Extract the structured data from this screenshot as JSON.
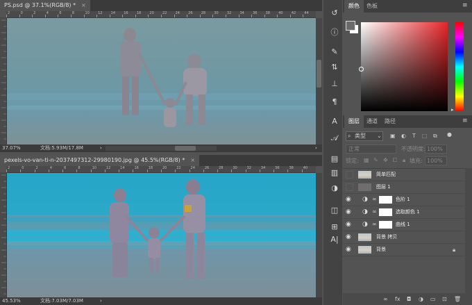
{
  "doc1": {
    "tab_title": "PS.psd @ 37.1%(RGB/8) *",
    "zoom": "37.07%",
    "doc_info": "文档:5.93M/17.8M",
    "ruler_labels": [
      "2",
      "0",
      "2",
      "4",
      "6",
      "8",
      "10",
      "12",
      "14",
      "16",
      "18",
      "20",
      "22",
      "24",
      "26",
      "28",
      "30",
      "32",
      "34",
      "36",
      "38",
      "40",
      "42",
      "44"
    ]
  },
  "doc2": {
    "tab_title": "pexels-vo-van-ti-n-2037497312-29980190.jpg @ 45.5%(RGB/8) *",
    "zoom": "45.53%",
    "doc_info": "文档:7.03M/7.03M",
    "ruler_labels": [
      "2",
      "0",
      "2",
      "4",
      "6",
      "8",
      "10",
      "12",
      "14",
      "16",
      "18",
      "20",
      "22",
      "24",
      "26",
      "28",
      "30",
      "32",
      "34",
      "36",
      "38",
      "40"
    ]
  },
  "tools": [
    "history-icon",
    "info-icon",
    "brush-icon",
    "adjust-icon",
    "clone-stamp-icon",
    "paragraph-icon",
    "character-icon",
    "glyphs-icon",
    "properties-icon",
    "libraries-icon",
    "adjustments-icon",
    "paths-icon",
    "swatches-icon",
    "character-style-icon"
  ],
  "color_panel": {
    "tabs": [
      "颜色",
      "色板"
    ],
    "fg": "#6b6b6b",
    "bg": "#ffffff",
    "hue_base": "#e8262a"
  },
  "layers_panel": {
    "tabs": [
      "图层",
      "通道",
      "路径"
    ],
    "filter_label": "类型",
    "blend_mode": "正常",
    "opacity_label": "不透明度:",
    "opacity_value": "100%",
    "lock_label": "锁定:",
    "fill_label": "填充:",
    "fill_value": "100%",
    "layers": [
      {
        "name": "简单匹配",
        "visible": false,
        "kind": "image",
        "indent": false
      },
      {
        "name": "图层 1",
        "visible": false,
        "kind": "gray",
        "indent": false
      },
      {
        "name": "色阶 1",
        "visible": true,
        "kind": "adjust",
        "indent": true
      },
      {
        "name": "选取颜色 1",
        "visible": true,
        "kind": "adjust",
        "indent": true
      },
      {
        "name": "曲线 1",
        "visible": true,
        "kind": "adjust",
        "indent": true
      },
      {
        "name": "背景 拷贝",
        "visible": true,
        "kind": "image",
        "indent": false
      },
      {
        "name": "背景",
        "visible": true,
        "kind": "image",
        "indent": false,
        "locked": true
      }
    ],
    "bottom_icons": [
      "link-icon",
      "fx-icon",
      "mask-icon",
      "adjustment-layer-icon",
      "group-icon",
      "new-layer-icon",
      "trash-icon"
    ]
  }
}
